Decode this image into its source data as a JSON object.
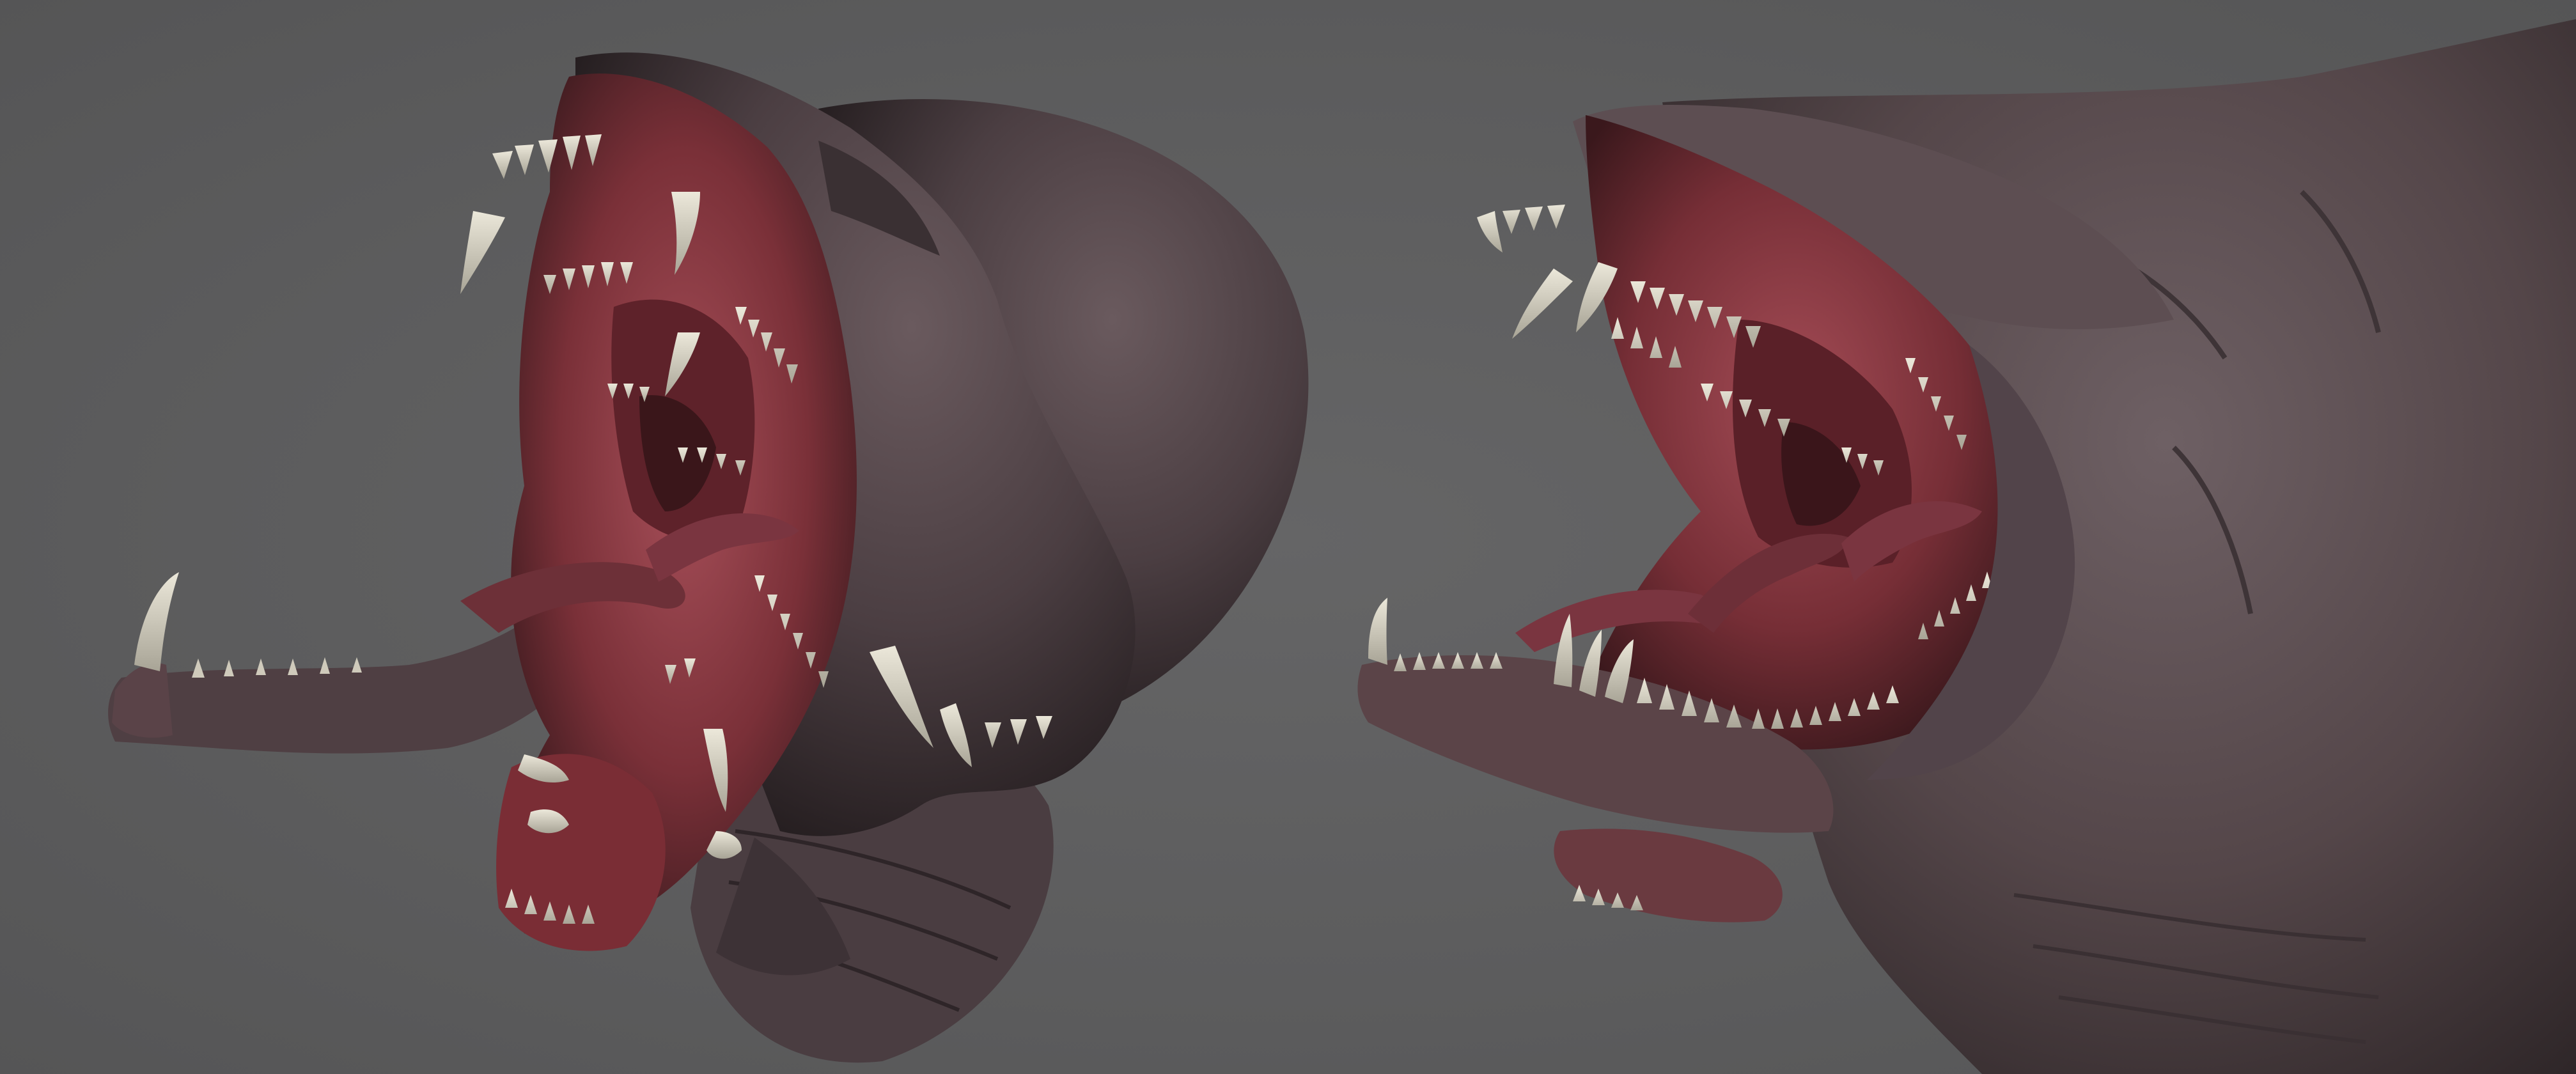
{
  "scene": {
    "background_color": "#5f5f60",
    "skin_color": "#5a4c50",
    "skin_dark": "#2e2628",
    "gum_color": "#8e3c46",
    "gum_dark": "#4a1e24",
    "tooth_color": "#d6d2c4",
    "views": [
      {
        "name": "front-three-quarter-view",
        "subject": "creature-head"
      },
      {
        "name": "side-view",
        "subject": "creature-head"
      }
    ]
  }
}
